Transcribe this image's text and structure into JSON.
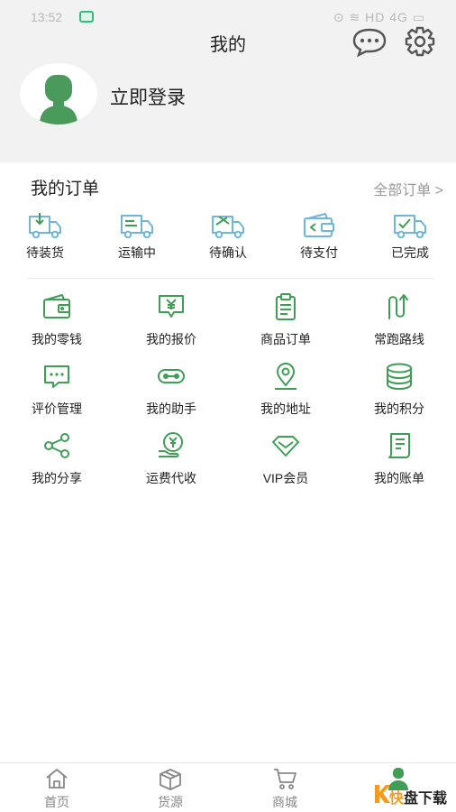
{
  "status_bar": {
    "time": "13:52",
    "right": "⊙ ≋ HD 4G ▭"
  },
  "header": {
    "title": "我的",
    "login_text": "立即登录"
  },
  "orders": {
    "title": "我的订单",
    "all_link": "全部订单 >",
    "items": [
      {
        "label": "待装货",
        "icon": "truck-loading-icon"
      },
      {
        "label": "运输中",
        "icon": "truck-moving-icon"
      },
      {
        "label": "待确认",
        "icon": "truck-confirm-icon"
      },
      {
        "label": "待支付",
        "icon": "wallet-pay-icon"
      },
      {
        "label": "已完成",
        "icon": "truck-done-icon"
      }
    ]
  },
  "services": [
    {
      "label": "我的零钱",
      "icon": "wallet-icon"
    },
    {
      "label": "我的报价",
      "icon": "quote-icon"
    },
    {
      "label": "商品订单",
      "icon": "clipboard-icon"
    },
    {
      "label": "常跑路线",
      "icon": "route-icon"
    },
    {
      "label": "评价管理",
      "icon": "comment-icon"
    },
    {
      "label": "我的助手",
      "icon": "assistant-icon"
    },
    {
      "label": "我的地址",
      "icon": "location-icon"
    },
    {
      "label": "我的积分",
      "icon": "coins-icon"
    },
    {
      "label": "我的分享",
      "icon": "share-icon"
    },
    {
      "label": "运费代收",
      "icon": "freight-collect-icon"
    },
    {
      "label": "VIP会员",
      "icon": "diamond-icon"
    },
    {
      "label": "我的账单",
      "icon": "bill-icon"
    }
  ],
  "tabbar": [
    {
      "label": "首页",
      "icon": "home-icon"
    },
    {
      "label": "货源",
      "icon": "box-icon"
    },
    {
      "label": "商城",
      "icon": "cart-icon"
    }
  ],
  "watermark": {
    "k": "K",
    "fast": "快",
    "rest": "盘下载"
  },
  "colors": {
    "accent": "#3f9e55",
    "header_bg": "#f2f2f2",
    "order_blue": "#6fb6dc"
  }
}
